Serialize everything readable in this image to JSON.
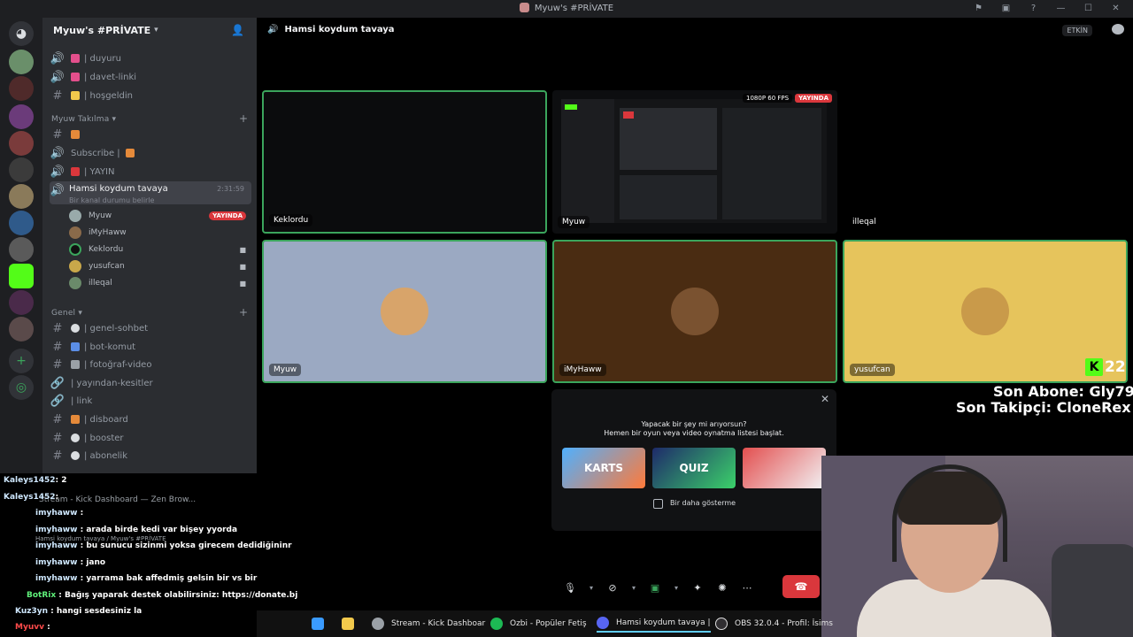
{
  "window": {
    "title": "Myuw's #PRİVATE"
  },
  "guild": {
    "name": "Myuw's #PRİVATE"
  },
  "channels": {
    "top": [
      {
        "icon": "speaker-icon",
        "label": "| duyuru"
      },
      {
        "icon": "speaker-icon",
        "label": "| davet-linki"
      },
      {
        "icon": "hash-icon",
        "label": "| hoşgeldin"
      }
    ],
    "cat_takilma": "Myuw Takılma",
    "takilma": [
      {
        "icon": "hash-icon",
        "label": ""
      },
      {
        "icon": "speaker-icon",
        "label": "Subscribe |"
      },
      {
        "icon": "speaker-icon",
        "label": "| YAYIN"
      }
    ],
    "active_voice": {
      "label": "Hamsi koydum tavaya",
      "status": "Bir kanal durumu belirle",
      "timer": "2:31:59"
    },
    "voice_users": [
      {
        "name": "Myuw",
        "badge": "YAYINDA"
      },
      {
        "name": "iMyHaww"
      },
      {
        "name": "Keklordu"
      },
      {
        "name": "yusufcan"
      },
      {
        "name": "illeqal"
      }
    ],
    "cat_genel": "Genel",
    "genel": [
      {
        "icon": "hash-icon",
        "label": "| genel-sohbet"
      },
      {
        "icon": "hash-icon",
        "label": "| bot-komut"
      },
      {
        "icon": "hash-icon",
        "label": "| fotoğraf-video"
      },
      {
        "icon": "link-icon",
        "label": "| yayından-kesitler"
      },
      {
        "icon": "link-icon",
        "label": "| link"
      },
      {
        "icon": "hash-icon",
        "label": "| disboard"
      },
      {
        "icon": "hash-icon",
        "label": "| booster"
      },
      {
        "icon": "hash-icon",
        "label": "| abonelik"
      }
    ]
  },
  "call": {
    "title": "Hamsi koydum tavaya",
    "activity_button": "ETKİN",
    "tiles": [
      {
        "name": "Keklordu"
      },
      {
        "name": "Myuw",
        "fps": "1080P 60 FPS",
        "live": "YAYINDA"
      },
      {
        "name": "illeqal"
      },
      {
        "name": "Myuw"
      },
      {
        "name": "iMyHaww"
      },
      {
        "name": "yusufcan"
      }
    ],
    "popup": {
      "line1": "Yapacak bir şey mi arıyorsun?",
      "line2": "Hemen bir oyun veya video oynatma listesi başlat.",
      "activities": [
        "KARTS",
        "QUIZ",
        ""
      ],
      "checkbox_label": "Bir daha gösterme"
    }
  },
  "overlay": {
    "kick_count": "22",
    "last_sub": "Son Abone: Gly79",
    "last_follower": "Son Takipçi: CloneRex"
  },
  "chat_overlay": [
    {
      "user": "Kaleys1452",
      "text": ": 2"
    },
    {
      "user": "Kaleys1452",
      "text": ":"
    },
    {
      "user": "imyhaww",
      "text": " :"
    },
    {
      "user": "imyhaww",
      "text": " : arada birde kedi var bişey yyorda"
    },
    {
      "user": "imyhaww",
      "text": " : bu sunucu sizinmi yoksa girecem dedidiğininr"
    },
    {
      "user": "imyhaww",
      "text": " : jano"
    },
    {
      "user": "imyhaww",
      "text": " : yarrama bak affedmiş gelsin bir vs bir"
    },
    {
      "user": "BotRix",
      "text": " : Bağış yaparak destek olabilirsiniz: https://donate.bj"
    },
    {
      "user": "Kuz3yn",
      "text": " : hangi sesdesiniz la"
    },
    {
      "user": "Myuvv",
      "text": " :"
    }
  ],
  "chat_ghost": {
    "stream_tab": "Stream - Kick Dashboard — Zen Brow...",
    "sub": "Hamsi koydum tavaya / Myuw's #PRİVATE"
  },
  "taskbar": [
    {
      "label": ""
    },
    {
      "label": ""
    },
    {
      "label": "Stream - Kick Dashboar"
    },
    {
      "label": "Ozbi - Popüler Fetiş"
    },
    {
      "label": "Hamsi koydum tavaya |"
    },
    {
      "label": "OBS 32.0.4 - Profil: İsims"
    }
  ],
  "colors": {
    "accent_green": "#3ba55c",
    "live_red": "#da373c",
    "kick_green": "#53fc18"
  }
}
